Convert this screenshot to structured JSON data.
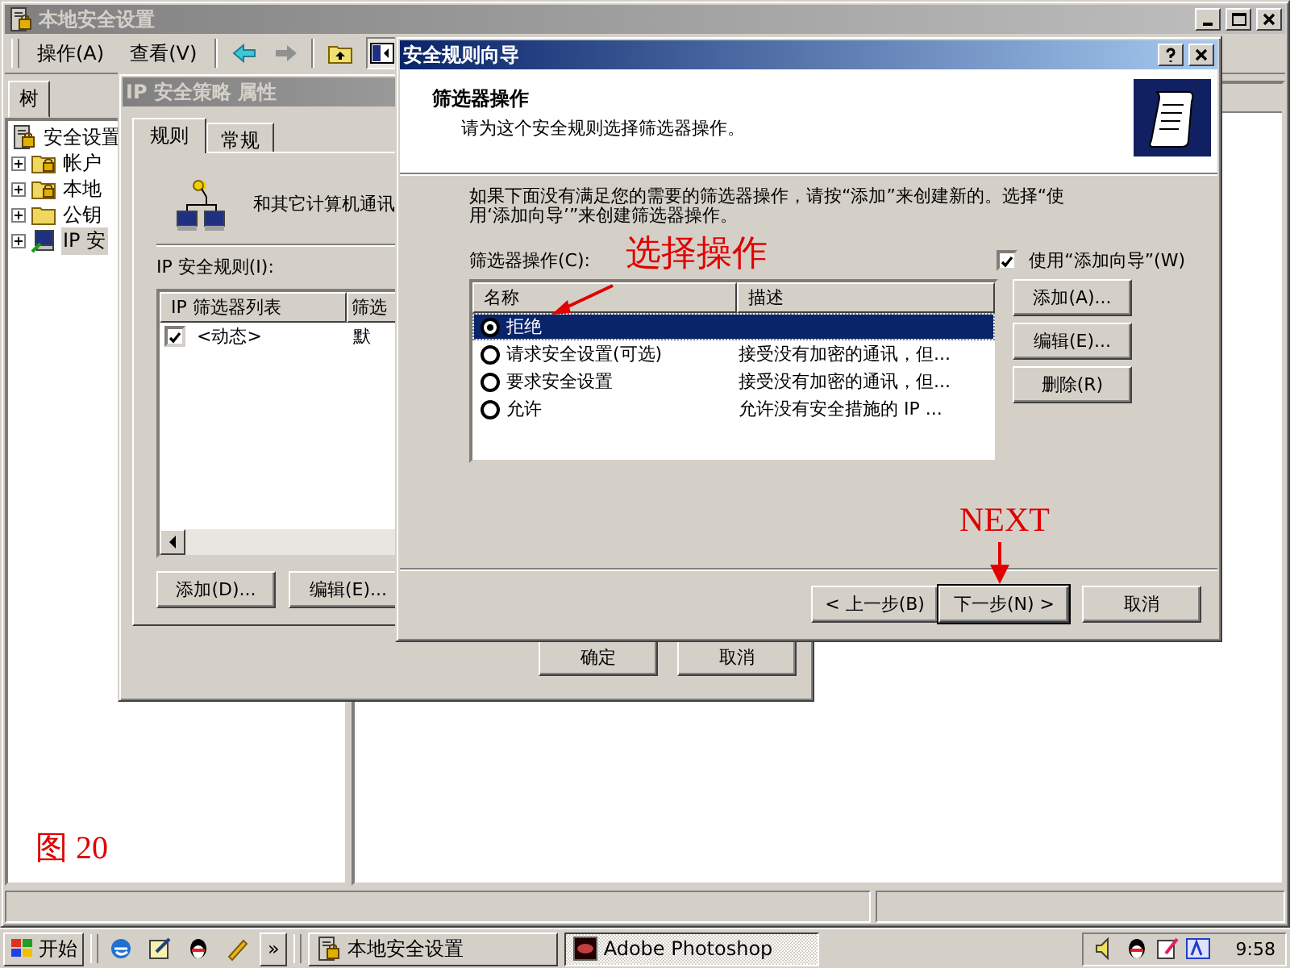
{
  "main_window": {
    "title": "本地安全设置",
    "menu": [
      "操作(A)",
      "查看(V)"
    ],
    "tree_tab": "树",
    "tree": [
      {
        "label": "安全设置",
        "kind": "policy",
        "selected": false,
        "children": [
          {
            "label": "帐户",
            "kind": "locked-folder",
            "expanded": false,
            "selected": false
          },
          {
            "label": "本地",
            "kind": "locked-folder",
            "expanded": false,
            "selected": false
          },
          {
            "label": "公钥",
            "kind": "folder",
            "expanded": false,
            "selected": false
          },
          {
            "label": "IP 安",
            "kind": "ip-policy",
            "expanded": false,
            "selected": true
          }
        ]
      }
    ]
  },
  "ip_policy_dialog": {
    "title": "IP 安全策略 属性",
    "tabs": [
      {
        "label": "规则",
        "selected": true
      },
      {
        "label": "常规",
        "selected": false
      }
    ],
    "description": "和其它计算机通讯",
    "rules_label": "IP 安全规则(I):",
    "columns": [
      "IP 筛选器列表",
      "筛选"
    ],
    "rows": [
      {
        "checked": true,
        "cells": [
          "<动态>",
          "默"
        ]
      }
    ],
    "buttons": [
      "添加(D)...",
      "编辑(E)..."
    ],
    "footer_buttons": [
      "确定",
      "取消"
    ]
  },
  "wizard": {
    "title": "安全规则向导",
    "heading": "筛选器操作",
    "subheading": "请为这个安全规则选择筛选器操作。",
    "intro": "如果下面没有满足您的需要的筛选器操作，请按“添加”来创建新的。选择“使用‘添加向导’”来创建筛选器操作。",
    "action_label": "筛选器操作(C):",
    "use_wizard": {
      "label": "使用“添加向导”(W)",
      "checked": true
    },
    "columns": [
      "名称",
      "描述"
    ],
    "actions": [
      {
        "name": "拒绝",
        "selected": true
      },
      {
        "name": "请求安全设置(可选)",
        "description": "接受没有加密的通讯，但...",
        "selected": false
      },
      {
        "name": "要求安全设置",
        "description": "接受没有加密的通讯，但...",
        "selected": false
      },
      {
        "name": "允许",
        "description": "允许没有安全措施的 IP ...",
        "selected": false
      }
    ],
    "side_buttons": [
      "添加(A)...",
      "编辑(E)...",
      "删除(R)"
    ],
    "nav_buttons": [
      {
        "label": "< 上一步(B)",
        "default": false
      },
      {
        "label": "下一步(N) >",
        "default": true
      },
      {
        "label": "取消",
        "default": false
      }
    ]
  },
  "annotations": {
    "action_note": "选择操作",
    "next_note": "NEXT",
    "figure_label": "图 20"
  },
  "taskbar": {
    "start": "开始",
    "more": "»",
    "tasks": [
      {
        "label": "本地安全设置",
        "selected": false
      },
      {
        "label": "Adobe Photoshop",
        "selected": true
      }
    ],
    "clock": "9:58"
  }
}
